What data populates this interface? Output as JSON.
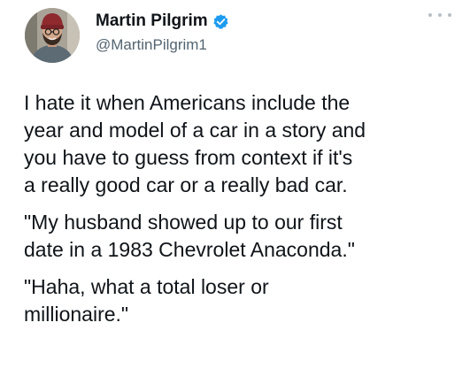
{
  "author": {
    "display_name": "Martin Pilgrim",
    "handle": "@MartinPilgrim1",
    "avatar_icon": "profile-photo",
    "verified_icon": "verified-badge-icon",
    "verified_color": "#1d9bf0"
  },
  "menu": {
    "icon": "more-options-icon"
  },
  "tweet": {
    "paragraphs": [
      "I hate it when Americans include the\nyear and model of a car in a story and\nyou have to guess from context if it's\na really good car or a really bad car.",
      "\"My husband showed up to our first\ndate in a 1983 Chevrolet Anaconda.\"",
      "\"Haha, what a total loser or\nmillionaire.\""
    ]
  },
  "colors": {
    "text": "#0f1419",
    "secondary_text": "#536471",
    "background": "#ffffff"
  }
}
